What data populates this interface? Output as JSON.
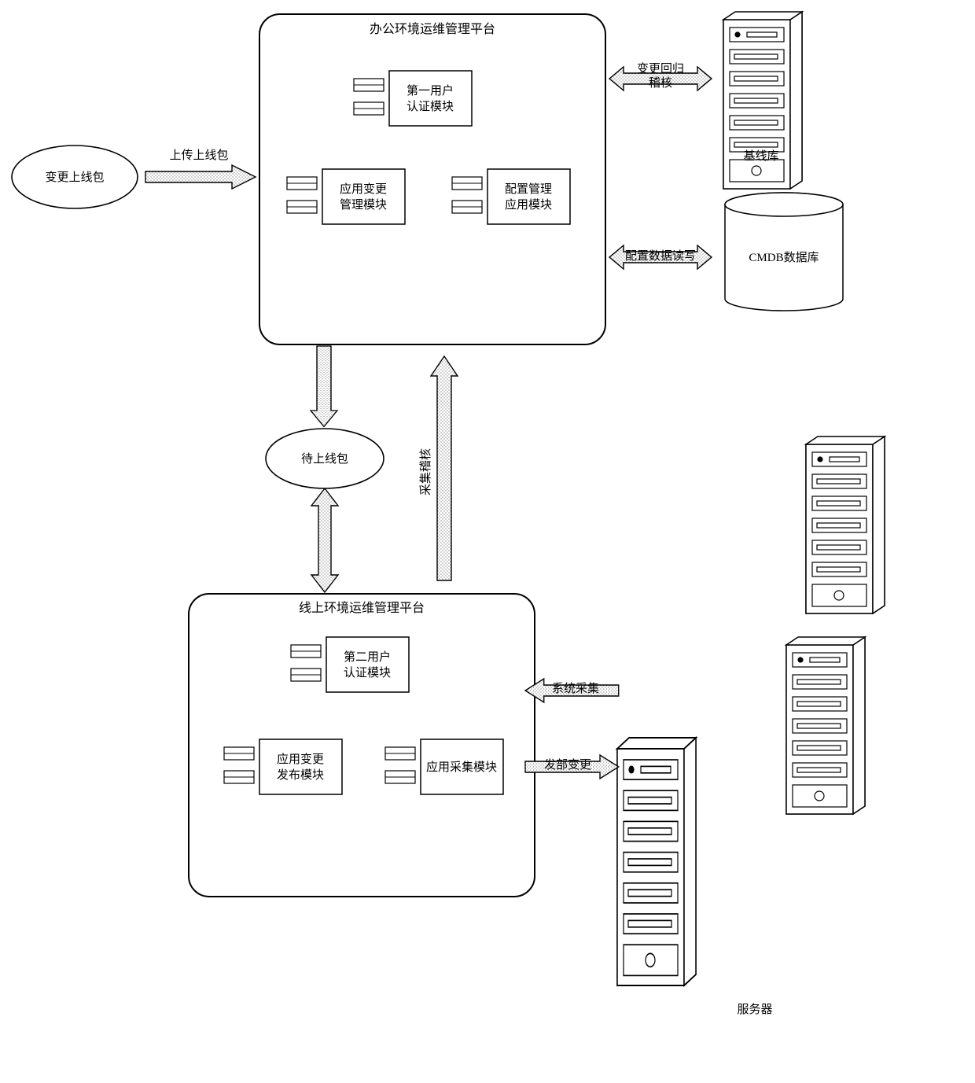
{
  "platforms": {
    "office": {
      "title": "办公环境运维管理平台",
      "modules": {
        "user_auth": "第一用户\n认证模块",
        "app_change": "应用变更\n管理模块",
        "config_mgmt": "配置管理\n应用模块"
      }
    },
    "online": {
      "title": "线上环境运维管理平台",
      "modules": {
        "user_auth": "第二用户\n认证模块",
        "app_publish": "应用变更\n发布模块",
        "app_collect": "应用采集模块"
      }
    }
  },
  "nodes": {
    "change_pkg": "变更上线包",
    "pending_pkg": "待上线包",
    "baseline": "基线库",
    "cmdb": "CMDB数据库",
    "servers": "服务器"
  },
  "arrows": {
    "upload": "上传上线包",
    "regression": "变更回归\n稽核",
    "config_rw": "配置数据读写",
    "collect_audit": "采集稽核",
    "sys_collect": "系统采集",
    "deploy": "发部变更"
  }
}
